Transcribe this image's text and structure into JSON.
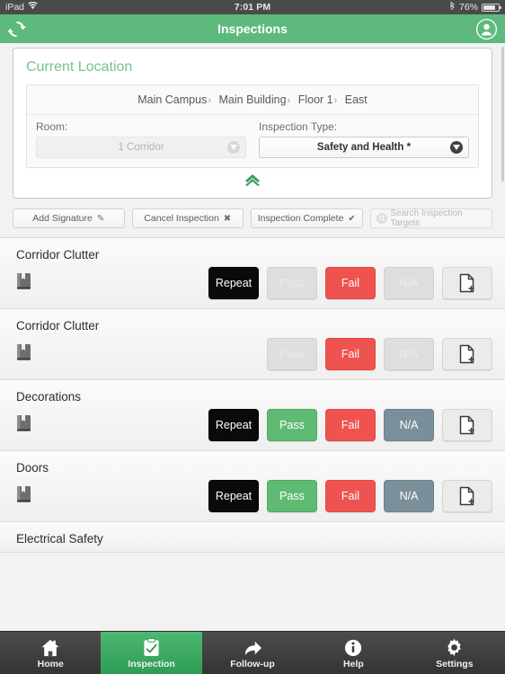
{
  "status_bar": {
    "device": "iPad",
    "wifi_icon": "wifi-icon",
    "time": "7:01 PM",
    "bluetooth_icon": "bluetooth-icon",
    "battery_percent": "76%",
    "battery_icon": "battery-icon"
  },
  "nav_bar": {
    "title": "Inspections",
    "refresh_icon": "refresh-icon",
    "account_icon": "account-icon",
    "background_color": "#5eb97d"
  },
  "current_location": {
    "heading": "Current Location",
    "breadcrumbs": [
      "Main Campus",
      "Main Building",
      "Floor 1",
      "East"
    ],
    "breadcrumb_separator": "›",
    "room": {
      "label": "Room:",
      "value": "1 Corridor",
      "disabled": true,
      "caret_icon": "chevron-down-icon"
    },
    "inspection_type": {
      "label": "Inspection Type:",
      "value": "Safety and Health *",
      "disabled": false,
      "caret_icon": "chevron-down-icon"
    },
    "collapse_icon": "double-chevron-up-icon"
  },
  "toolbar": {
    "add_signature": {
      "label": "Add Signature",
      "icon": "pencil-icon",
      "glyph": "✎"
    },
    "cancel_inspection": {
      "label": "Cancel Inspection",
      "icon": "close-icon",
      "glyph": "✖"
    },
    "inspection_complete": {
      "label": "Inspection Complete",
      "icon": "check-icon",
      "glyph": "✔"
    },
    "search": {
      "placeholder": "Search Inspection Targets",
      "icon": "search-icon",
      "value": ""
    }
  },
  "colors": {
    "accent_green": "#5eb97d",
    "pass_green": "#5fba74",
    "fail_red": "#ef5350",
    "na_slate": "#7a8f99",
    "repeat_black": "#0a0a0a",
    "disabled_gray": "#dedede"
  },
  "inspection_items": [
    {
      "name": "Corridor Clutter",
      "book_icon": "book-icon",
      "note_icon": "add-note-icon",
      "buttons": [
        {
          "label": "Repeat",
          "state": "repeat-on"
        },
        {
          "label": "Pass",
          "state": "off"
        },
        {
          "label": "Fail",
          "state": "fail-on"
        },
        {
          "label": "N/A",
          "state": "off"
        }
      ]
    },
    {
      "name": "Corridor Clutter",
      "book_icon": "book-icon",
      "note_icon": "add-note-icon",
      "buttons": [
        {
          "label": "",
          "state": "spacer"
        },
        {
          "label": "Pass",
          "state": "off"
        },
        {
          "label": "Fail",
          "state": "fail-on"
        },
        {
          "label": "N/A",
          "state": "off"
        }
      ]
    },
    {
      "name": "Decorations",
      "book_icon": "book-icon",
      "note_icon": "add-note-icon",
      "buttons": [
        {
          "label": "Repeat",
          "state": "repeat-on"
        },
        {
          "label": "Pass",
          "state": "pass-on"
        },
        {
          "label": "Fail",
          "state": "fail-on"
        },
        {
          "label": "N/A",
          "state": "na-on"
        }
      ]
    },
    {
      "name": "Doors",
      "book_icon": "book-icon",
      "note_icon": "add-note-icon",
      "buttons": [
        {
          "label": "Repeat",
          "state": "repeat-on"
        },
        {
          "label": "Pass",
          "state": "pass-on"
        },
        {
          "label": "Fail",
          "state": "fail-on"
        },
        {
          "label": "N/A",
          "state": "na-on"
        }
      ]
    },
    {
      "name": "Electrical Safety",
      "book_icon": "book-icon",
      "note_icon": "add-note-icon",
      "buttons": []
    }
  ],
  "tab_bar": {
    "items": [
      {
        "label": "Home",
        "icon": "home-icon",
        "active": false
      },
      {
        "label": "Inspection",
        "icon": "clipboard-icon",
        "active": true
      },
      {
        "label": "Follow-up",
        "icon": "arrow-icon",
        "active": false
      },
      {
        "label": "Help",
        "icon": "info-icon",
        "active": false
      },
      {
        "label": "Settings",
        "icon": "gear-icon",
        "active": false
      }
    ]
  }
}
